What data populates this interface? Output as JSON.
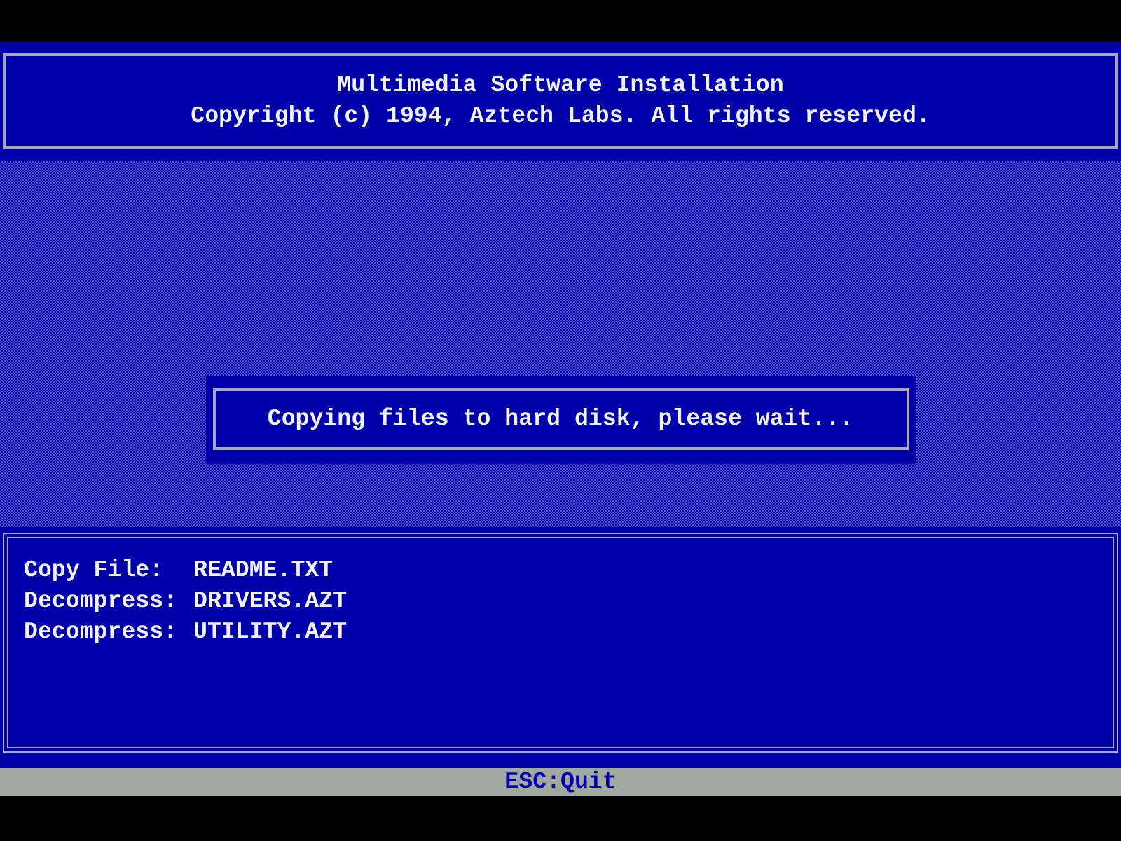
{
  "header": {
    "title": "Multimedia Software Installation",
    "copyright": "Copyright (c) 1994, Aztech Labs. All rights reserved."
  },
  "dialog": {
    "message": "Copying files to hard disk, please wait..."
  },
  "log": [
    {
      "action": "Copy File:",
      "file": "README.TXT"
    },
    {
      "action": "Decompress:",
      "file": "DRIVERS.AZT"
    },
    {
      "action": "Decompress:",
      "file": "UTILITY.AZT"
    }
  ],
  "status_bar": {
    "hint": "ESC:Quit"
  }
}
